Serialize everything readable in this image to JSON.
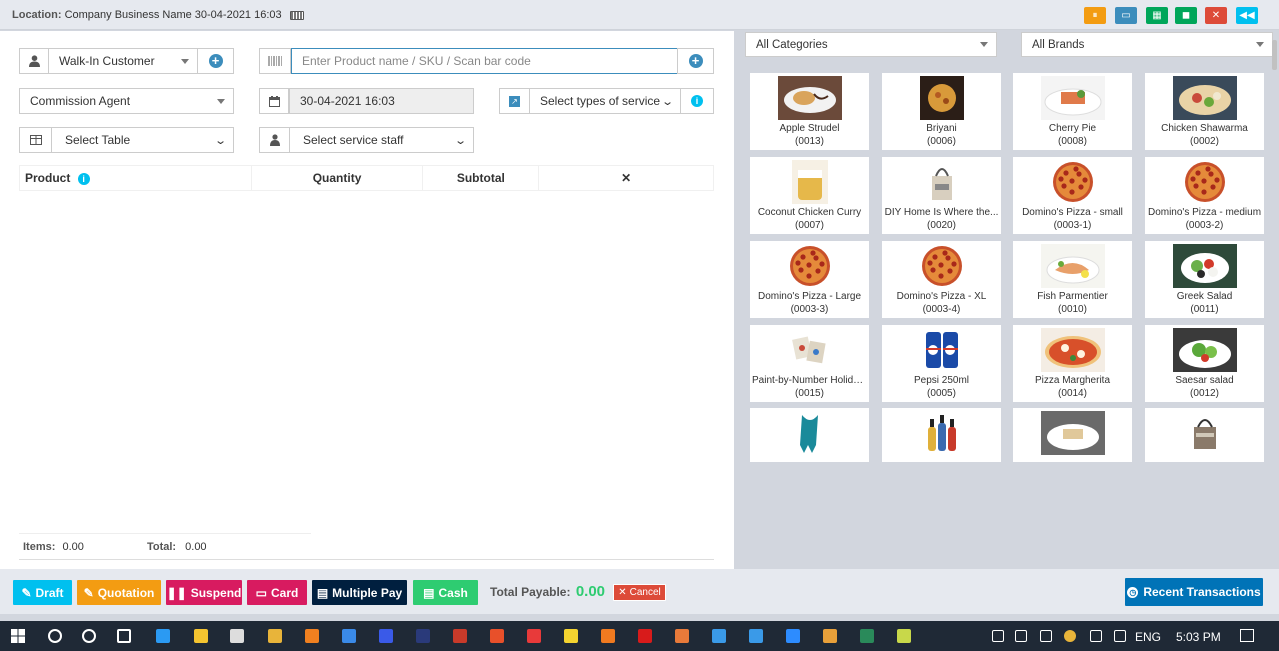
{
  "topbar": {
    "location_label": "Location:",
    "location_value": "Company Business Name 30-04-2021 16:03"
  },
  "toolbar_icons": [
    {
      "name": "pause-icon",
      "color": "#f39c12",
      "glyph": "⏸"
    },
    {
      "name": "window-icon",
      "color": "#3c8dbc",
      "glyph": "▭"
    },
    {
      "name": "calculator-icon",
      "color": "#00a65a",
      "glyph": "▦"
    },
    {
      "name": "briefcase-icon",
      "color": "#00a65a",
      "glyph": "◼"
    },
    {
      "name": "close-window-icon",
      "color": "#dd4b39",
      "glyph": "✕"
    },
    {
      "name": "backward-icon",
      "color": "#00c0ef",
      "glyph": "◀◀"
    }
  ],
  "customer": {
    "value": "Walk-In Customer"
  },
  "search": {
    "placeholder": "Enter Product name / SKU / Scan bar code"
  },
  "commission_agent": {
    "value": "Commission Agent"
  },
  "date": {
    "value": "30-04-2021 16:03"
  },
  "service_type": {
    "value": "Select types of service"
  },
  "table_select": {
    "value": "Select Table"
  },
  "service_staff": {
    "value": "Select service staff"
  },
  "cart": {
    "headers": {
      "product": "Product",
      "quantity": "Quantity",
      "subtotal": "Subtotal",
      "remove": "✕"
    }
  },
  "totals": {
    "items_label": "Items:",
    "items_value": "0.00",
    "total_label": "Total:",
    "total_value": "0.00"
  },
  "filters": {
    "category": "All Categories",
    "brand": "All Brands"
  },
  "products": [
    {
      "name": "Apple Strudel",
      "sku": "(0013)",
      "kind": "dessert"
    },
    {
      "name": "Briyani",
      "sku": "(0006)",
      "kind": "rice"
    },
    {
      "name": "Cherry Pie",
      "sku": "(0008)",
      "kind": "plate"
    },
    {
      "name": "Chicken Shawarma",
      "sku": "(0002)",
      "kind": "wrap"
    },
    {
      "name": "Coconut Chicken Curry",
      "sku": "(0007)",
      "kind": "cup"
    },
    {
      "name": "DIY Home Is Where the...",
      "sku": "(0020)",
      "kind": "bag"
    },
    {
      "name": "Domino's Pizza - small",
      "sku": "(0003-1)",
      "kind": "pizza"
    },
    {
      "name": "Domino's Pizza - medium",
      "sku": "(0003-2)",
      "kind": "pizza"
    },
    {
      "name": "Domino's Pizza - Large",
      "sku": "(0003-3)",
      "kind": "pizza"
    },
    {
      "name": "Domino's Pizza - XL",
      "sku": "(0003-4)",
      "kind": "pizza"
    },
    {
      "name": "Fish Parmentier",
      "sku": "(0010)",
      "kind": "fish"
    },
    {
      "name": "Greek Salad",
      "sku": "(0011)",
      "kind": "salad"
    },
    {
      "name": "Paint-by-Number Holida...",
      "sku": "(0015)",
      "kind": "cards"
    },
    {
      "name": "Pepsi 250ml",
      "sku": "(0005)",
      "kind": "cans"
    },
    {
      "name": "Pizza Margherita",
      "sku": "(0014)",
      "kind": "margherita"
    },
    {
      "name": "Saesar salad",
      "sku": "(0012)",
      "kind": "salad2"
    },
    {
      "name": "",
      "sku": "",
      "kind": "scarf"
    },
    {
      "name": "",
      "sku": "",
      "kind": "bottles"
    },
    {
      "name": "",
      "sku": "",
      "kind": "plate2"
    },
    {
      "name": "",
      "sku": "",
      "kind": "tote"
    }
  ],
  "footer": {
    "draft": "Draft",
    "quotation": "Quotation",
    "suspend": "Suspend",
    "card": "Card",
    "multiple_pay": "Multiple Pay",
    "cash": "Cash",
    "total_payable_label": "Total Payable:",
    "total_payable_value": "0.00",
    "cancel": "Cancel",
    "recent_transactions": "Recent Transactions"
  },
  "taskbar": {
    "lang": "ENG",
    "time": "5:03 PM"
  }
}
